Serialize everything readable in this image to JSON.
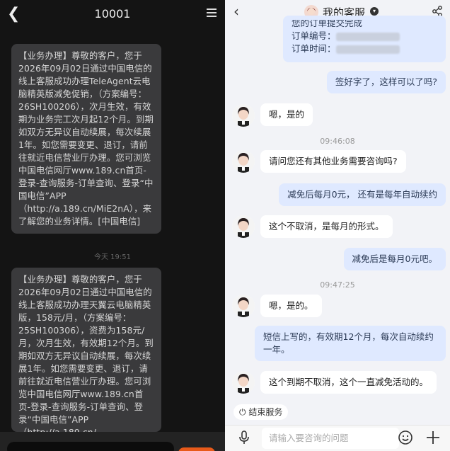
{
  "sms": {
    "title": "10001",
    "message1": "【业务办理】尊敬的客户，您于2026年09月02日通过中国电信的线上客服成功办理TeleAgent云电脑精英版减免促销，（方案编号：26SH100206），次月生效，有效期为业务完工次月起12个月。到期如双方无异议自动续展，每次续展1年。如您需要变更、退订，请前往就近电信营业厅办理。您可浏览中国电信网厅www.189.cn首页-登录-查询服务-订单查询、登录“中国电信”APP（http://a.189.cn/MiE2nA），来了解您的业务详情。[中国电信]",
    "time_divider": "今天 19:51",
    "message2": "【业务办理】尊敬的客户，您于2026年09月02日通过中国电信的线上客服成功办理天翼云电脑精英版，158元/月，（方案编号：25SH100306），资费为158元/月，次月生效，有效期12个月。到期如双方无异议自动续展，每次续展1年。如您需要变更、退订，请前往就近电信营业厅办理。您可浏览中国电信网厅www.189.cn首页-登录-查询服务-订单查询、登录“中国电信”APP（http://a.189.cn/..."
  },
  "chat": {
    "title": "我的客服",
    "order_line1": "您的订单提交完成",
    "order_line2": "订单编号：",
    "order_line3": "订单时间：",
    "m1": "签好字了，这样可以了吗?",
    "r1": "嗯，是的",
    "t1": "09:46:08",
    "r2": "请问您还有其他业务需要咨询吗?",
    "m2": "减免后每月0元， 还有是每年自动续约",
    "r3": "这个不取消，是每月的形式。",
    "m3": "减免后是每月0元吧。",
    "t2": "09:47:25",
    "r4": "嗯，是的。",
    "m4": "短信上写的，有效期12个月，每次自动续约一年。",
    "r5": "这个到期不取消，这个一直减免活动的。",
    "end_service": "结束服务",
    "input_placeholder": "请输入要咨询的问题"
  }
}
